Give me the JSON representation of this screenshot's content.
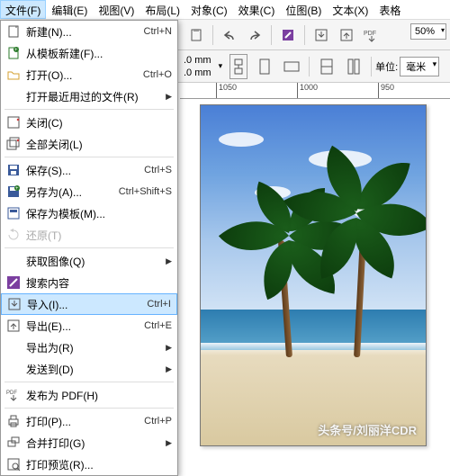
{
  "menubar": [
    "文件(F)",
    "编辑(E)",
    "视图(V)",
    "布局(L)",
    "对象(C)",
    "效果(C)",
    "位图(B)",
    "文本(X)",
    "表格"
  ],
  "zoom": "50%",
  "dim_w": ".0 mm",
  "dim_h": ".0 mm",
  "units_label": "单位:",
  "units_value": "毫米",
  "ruler_ticks": [
    "1050",
    "1000",
    "950"
  ],
  "menu": [
    {
      "icon": "new",
      "label": "新建(N)...",
      "sc": "Ctrl+N"
    },
    {
      "icon": "newtpl",
      "label": "从模板新建(F)..."
    },
    {
      "icon": "open",
      "label": "打开(O)...",
      "sc": "Ctrl+O"
    },
    {
      "label": "打开最近用过的文件(R)",
      "sub": true
    },
    {
      "sep": true
    },
    {
      "icon": "close",
      "label": "关闭(C)"
    },
    {
      "icon": "closeall",
      "label": "全部关闭(L)"
    },
    {
      "sep": true
    },
    {
      "icon": "save",
      "label": "保存(S)...",
      "sc": "Ctrl+S"
    },
    {
      "icon": "saveas",
      "label": "另存为(A)...",
      "sc": "Ctrl+Shift+S"
    },
    {
      "icon": "savetpl",
      "label": "保存为模板(M)..."
    },
    {
      "icon": "revert",
      "label": "还原(T)",
      "disabled": true
    },
    {
      "sep": true
    },
    {
      "label": "获取图像(Q)",
      "sub": true
    },
    {
      "icon": "search",
      "label": "搜索内容"
    },
    {
      "icon": "import",
      "label": "导入(I)...",
      "sc": "Ctrl+I",
      "hl": true
    },
    {
      "icon": "export",
      "label": "导出(E)...",
      "sc": "Ctrl+E"
    },
    {
      "label": "导出为(R)",
      "sub": true
    },
    {
      "label": "发送到(D)",
      "sub": true
    },
    {
      "sep": true
    },
    {
      "icon": "pdf",
      "label": "发布为 PDF(H)"
    },
    {
      "sep": true
    },
    {
      "icon": "print",
      "label": "打印(P)...",
      "sc": "Ctrl+P"
    },
    {
      "icon": "merge",
      "label": "合并打印(G)",
      "sub": true
    },
    {
      "icon": "preview",
      "label": "打印预览(R)..."
    }
  ],
  "watermark": "头条号/刘丽洋CDR"
}
